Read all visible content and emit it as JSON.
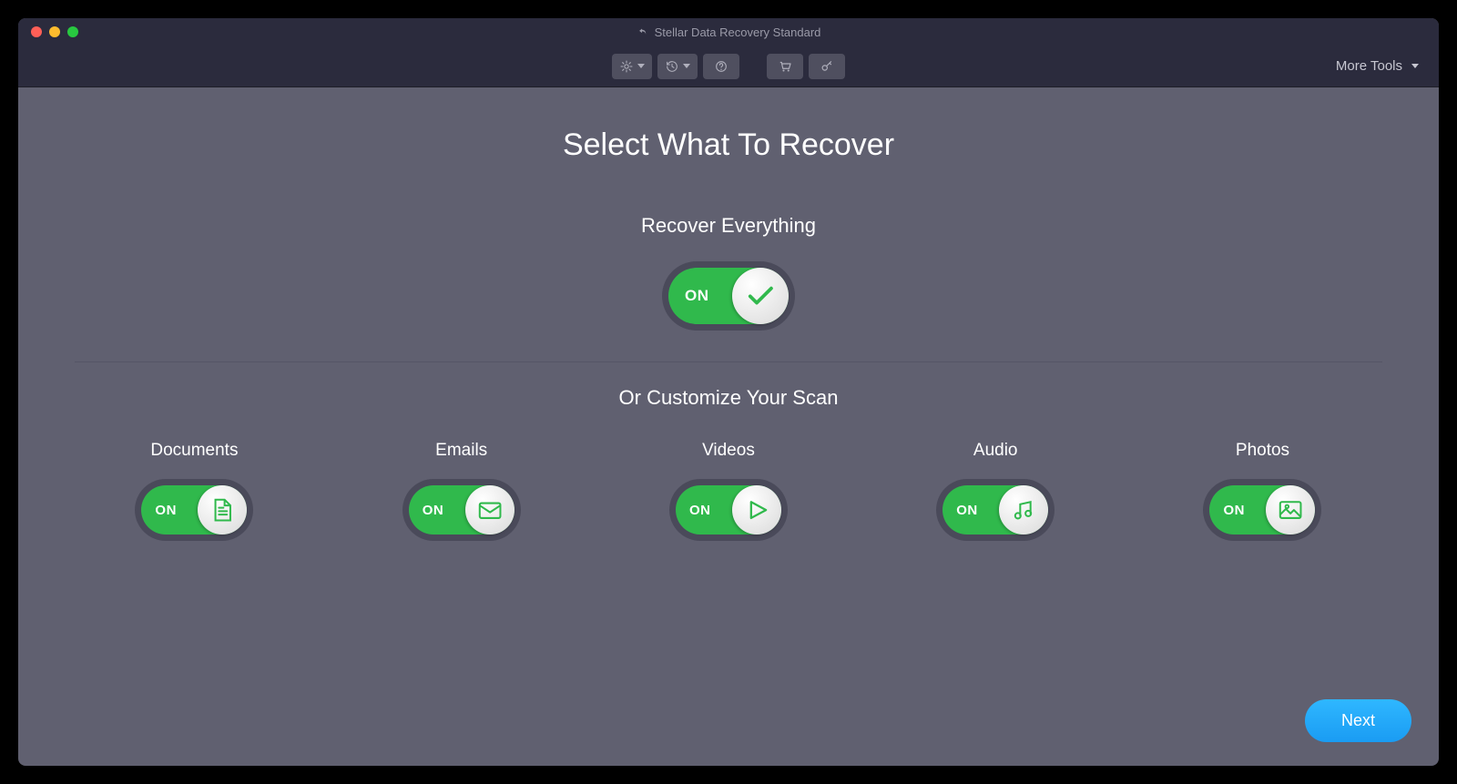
{
  "window": {
    "title": "Stellar Data Recovery Standard"
  },
  "toolbar": {
    "more_tools": "More Tools"
  },
  "page": {
    "title": "Select What To Recover",
    "recover_everything_label": "Recover Everything",
    "customize_label": "Or Customize Your Scan",
    "main_toggle": {
      "state": "ON",
      "icon": "check"
    }
  },
  "categories": [
    {
      "label": "Documents",
      "state": "ON",
      "icon": "document"
    },
    {
      "label": "Emails",
      "state": "ON",
      "icon": "email"
    },
    {
      "label": "Videos",
      "state": "ON",
      "icon": "video"
    },
    {
      "label": "Audio",
      "state": "ON",
      "icon": "audio"
    },
    {
      "label": "Photos",
      "state": "ON",
      "icon": "photo"
    }
  ],
  "footer": {
    "next": "Next"
  },
  "colors": {
    "accent_green": "#30b94c",
    "accent_blue": "#1a9cf3",
    "window_bg": "#606070",
    "chrome_bg": "#2b2b3d"
  }
}
